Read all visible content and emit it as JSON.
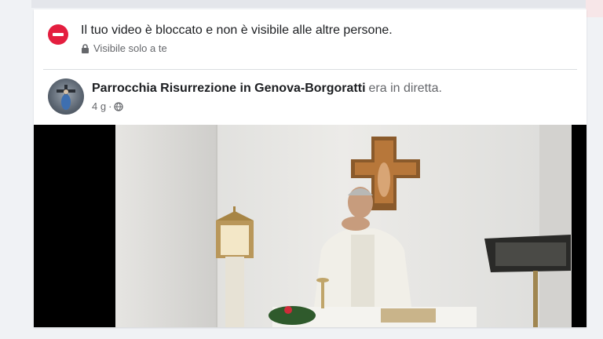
{
  "notice": {
    "title": "Il tuo video è bloccato e non è visibile alle altre persone.",
    "visibility": "Visibile solo a te",
    "icon": "no-entry-icon",
    "icon_color": "#e41e3f"
  },
  "post": {
    "page_name": "Parrocchia Risurrezione in Genova-Borgoratti",
    "status": "era in diretta.",
    "time": "4 g",
    "separator": "·",
    "privacy_icon": "globe-icon"
  },
  "video": {
    "description": "live-mass-video-frame"
  }
}
